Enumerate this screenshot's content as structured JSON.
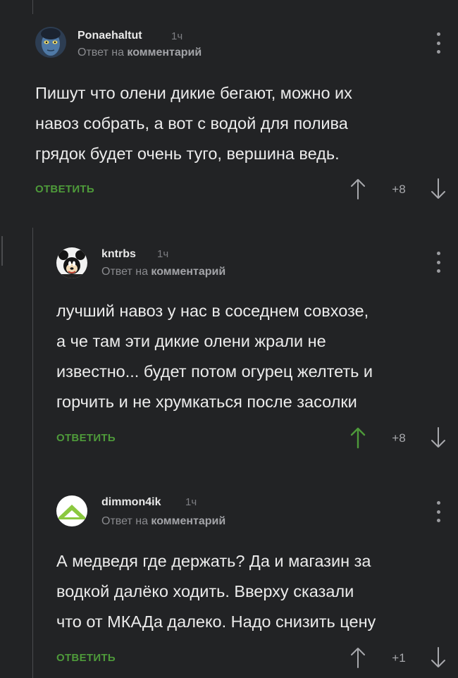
{
  "comments": [
    {
      "username": "Ponaehaltut",
      "time": "1ч",
      "reply_prefix": "Ответ на ",
      "reply_link": "комментарий",
      "lines": [
        "Пишут что олени дикие бегают, можно их",
        "навоз собрать, а вот с водой для полива",
        "грядок будет очень туго, вершина ведь."
      ],
      "reply_label": "ОТВЕТИТЬ",
      "score": "+8",
      "upvote_active": false,
      "upvote_color": "#a8a9ad",
      "avatar_icon": "avatar-navi-icon"
    },
    {
      "username": "kntrbs",
      "time": "1ч",
      "reply_prefix": "Ответ на ",
      "reply_link": "комментарий",
      "lines": [
        "лучший навоз у нас в соседнем совхозе,",
        "а че там эти дикие олени жрали не",
        "известно... будет потом огурец желтеть и",
        "горчить и не хрумкаться после засолки"
      ],
      "reply_label": "ОТВЕТИТЬ",
      "score": "+8",
      "upvote_active": true,
      "upvote_color": "#4e9a3a",
      "avatar_icon": "avatar-mickey-icon"
    },
    {
      "username": "dimmon4ik",
      "time": "1ч",
      "reply_prefix": "Ответ на ",
      "reply_link": "комментарий",
      "lines": [
        "А медведя где держать? Да и магазин за",
        "водкой далёко ходить. Вверху сказали",
        "что от МКАДа далеко. Надо снизить цену"
      ],
      "reply_label": "ОТВЕТИТЬ",
      "score": "+1",
      "upvote_active": false,
      "upvote_color": "#a8a9ad",
      "avatar_icon": "avatar-triangle-icon"
    }
  ],
  "colors": {
    "background": "#222325",
    "accent_green": "#4e9a3a",
    "thread_line": "#4a4b4e"
  }
}
